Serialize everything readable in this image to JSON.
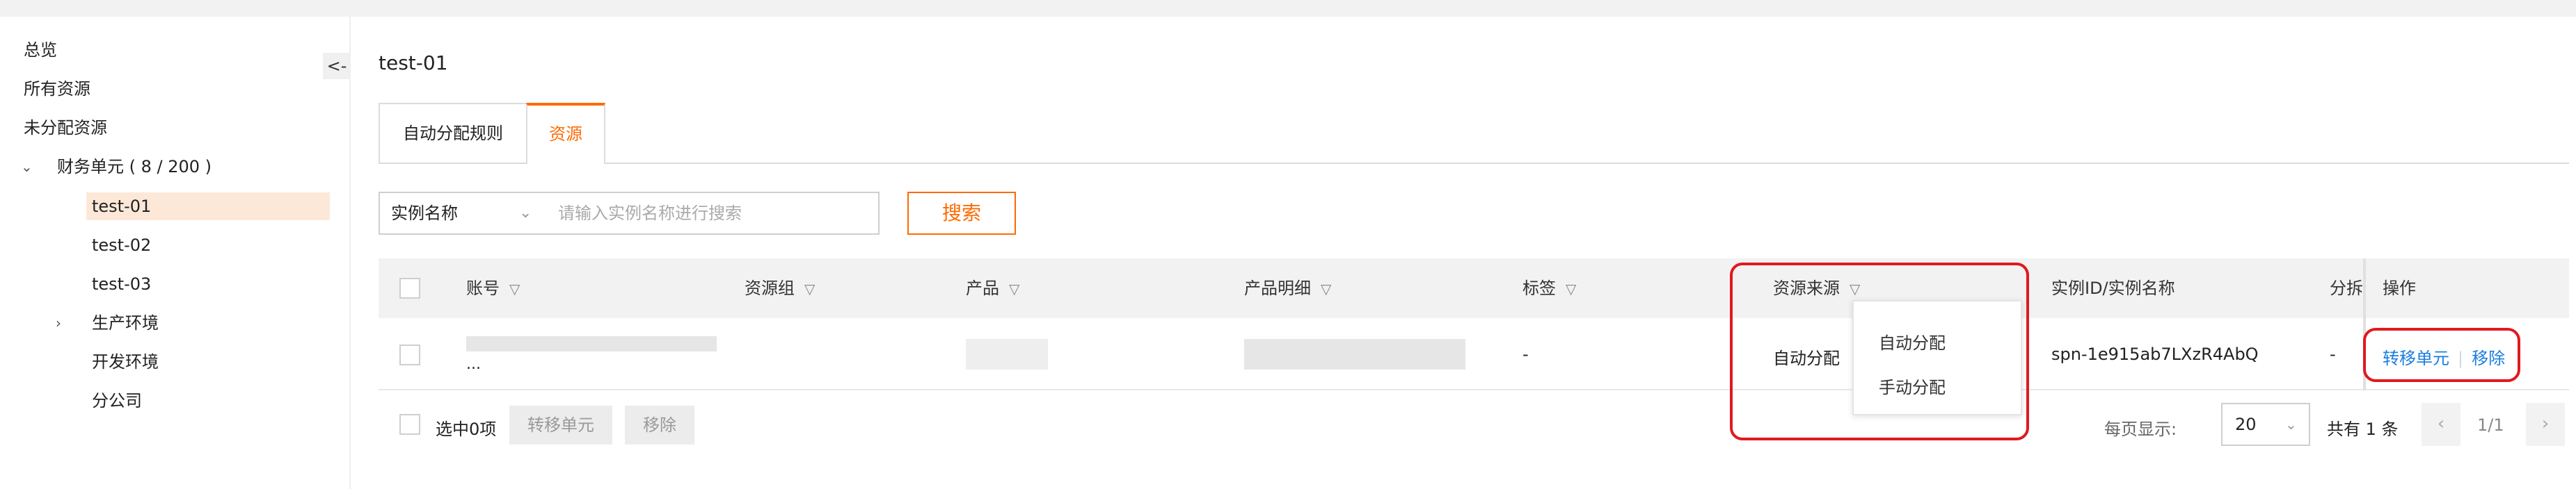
{
  "sidebar": {
    "collapse_label": "<-",
    "items": [
      {
        "label": "总览"
      },
      {
        "label": "所有资源"
      },
      {
        "label": "未分配资源"
      },
      {
        "label": "财务单元 ( 8 / 200 )"
      },
      {
        "label": "test-01"
      },
      {
        "label": "test-02"
      },
      {
        "label": "test-03"
      },
      {
        "label": "生产环境"
      },
      {
        "label": "开发环境"
      },
      {
        "label": "分公司"
      }
    ]
  },
  "page": {
    "title": "test-01"
  },
  "tabs": [
    {
      "label": "自动分配规则"
    },
    {
      "label": "资源",
      "active": true
    }
  ],
  "filter": {
    "field": "实例名称",
    "placeholder": "请输入实例名称进行搜索",
    "search_label": "搜索"
  },
  "table": {
    "columns": [
      "账号",
      "资源组",
      "产品",
      "产品明细",
      "标签",
      "资源来源",
      "实例ID/实例名称",
      "分拆",
      "操作"
    ],
    "rows": [
      {
        "account_suffix": "...",
        "tag": "-",
        "source": "自动分配",
        "instance": "spn-1e915ab7LXzR4AbQ",
        "split": "-",
        "actions": [
          "转移单元",
          "移除"
        ]
      }
    ]
  },
  "source_filter_options": [
    "自动分配",
    "手动分配"
  ],
  "footer": {
    "selected": "选中0项",
    "transfer_label": "转移单元",
    "remove_label": "移除",
    "page_size_label": "每页显示:",
    "page_size": "20",
    "total": "共有 1 条",
    "page": "1/1",
    "prev": "‹",
    "next": "›"
  },
  "colors": {
    "accent": "#ff6a00",
    "link": "#1a7de0",
    "annotation": "#e0191f"
  }
}
